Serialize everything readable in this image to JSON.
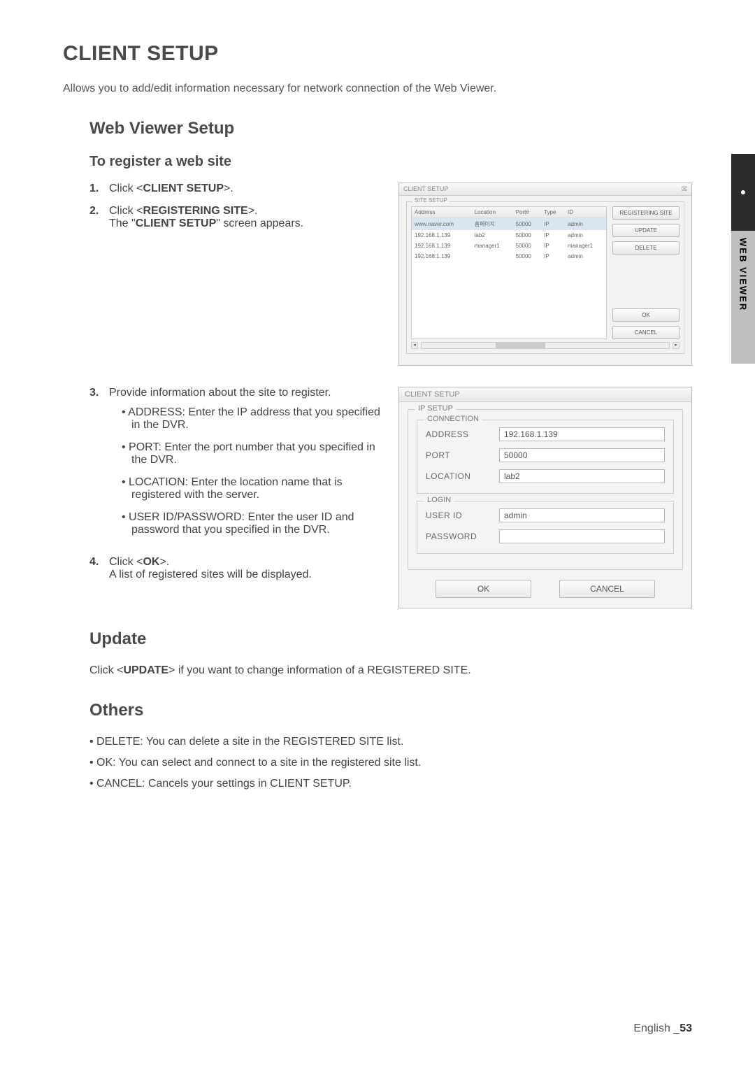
{
  "side": {
    "dot": "●",
    "label": "WEB VIEWER"
  },
  "h1": "CLIENT SETUP",
  "intro": "Allows you to add/edit information necessary for network connection of the Web Viewer.",
  "h2": "Web Viewer Setup",
  "h3_register": "To register a web site",
  "steps12": [
    {
      "num": "1.",
      "pre": "Click <",
      "bold": "CLIENT SETUP",
      "post": ">."
    },
    {
      "num": "2.",
      "pre": "Click <",
      "bold": "REGISTERING SITE",
      "post": ">.",
      "line2a": "The \"",
      "line2b": "CLIENT SETUP",
      "line2c": "\" screen appears."
    }
  ],
  "step3": {
    "num": "3.",
    "text": "Provide information about the site to register."
  },
  "bullets3": [
    "ADDRESS: Enter the IP address that you specified in the DVR.",
    "PORT: Enter the port number that you specified in the DVR.",
    "LOCATION: Enter the location name that is registered with the server.",
    "USER ID/PASSWORD: Enter the user ID and password that you specified in the DVR."
  ],
  "step4": {
    "num": "4.",
    "pre": "Click <",
    "bold": "OK",
    "post": ">.",
    "line2": "A list of registered sites will be displayed."
  },
  "h2_update": "Update",
  "update_line": {
    "pre": "Click <",
    "bold": "UPDATE",
    "post": "> if you want to change information of a REGISTERED SITE."
  },
  "h2_others": "Others",
  "others": [
    "DELETE: You can delete a site in the REGISTERED SITE list.",
    "OK: You can select and connect to a site in the registered site list.",
    "CANCEL: Cancels your settings in CLIENT SETUP."
  ],
  "footer": {
    "lang": "English",
    "sep": "_",
    "page": "53"
  },
  "dlg1": {
    "title": "CLIENT SETUP",
    "close": "☒",
    "group": "SITE SETUP",
    "headers": [
      "Address",
      "Location",
      "Port#",
      "Type",
      "ID"
    ],
    "rows": [
      {
        "sel": true,
        "c": [
          "www.naver.com",
          "홈페이지",
          "50000",
          "IP",
          "admin"
        ]
      },
      {
        "sel": false,
        "c": [
          "192.168.1.139",
          "lab2",
          "50000",
          "IP",
          "admin"
        ]
      },
      {
        "sel": false,
        "c": [
          "192.168.1.139",
          "manager1",
          "50000",
          "IP",
          "manager1"
        ]
      },
      {
        "sel": false,
        "c": [
          "192.168.1.139",
          "",
          "50000",
          "IP",
          "admin"
        ]
      }
    ],
    "btns": {
      "reg": "REGISTERING SITE",
      "upd": "UPDATE",
      "del": "DELETE",
      "ok": "OK",
      "cancel": "CANCEL"
    }
  },
  "dlg2": {
    "title": "CLIENT SETUP",
    "group_ip": "IP SETUP",
    "group_conn": "CONNECTION",
    "group_login": "LOGIN",
    "labels": {
      "address": "ADDRESS",
      "port": "PORT",
      "location": "LOCATION",
      "user": "USER ID",
      "pass": "PASSWORD"
    },
    "values": {
      "address": "192.168.1.139",
      "port": "50000",
      "location": "lab2",
      "user": "admin",
      "pass": ""
    },
    "ok": "OK",
    "cancel": "CANCEL"
  }
}
